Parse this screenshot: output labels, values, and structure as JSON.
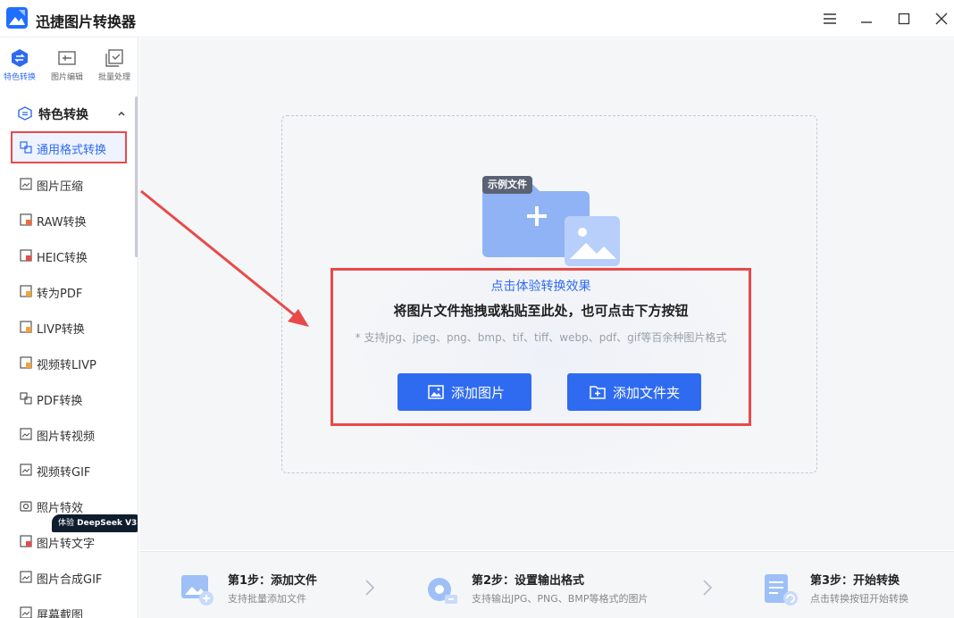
{
  "app": {
    "title": "迅捷图片转换器",
    "accent_color": "#2f6bf0",
    "highlight_color": "#e84a4a"
  },
  "window_controls": {
    "menu_icon": "hamburger-icon",
    "minimize_icon": "minimize-icon",
    "maximize_icon": "maximize-icon",
    "close_icon": "close-icon"
  },
  "top_tabs": [
    {
      "label": "特色转换",
      "icon": "swap-icon",
      "active": true
    },
    {
      "label": "图片编辑",
      "icon": "image-edit-icon",
      "active": false
    },
    {
      "label": "批量处理",
      "icon": "batch-icon",
      "active": false
    }
  ],
  "section": {
    "label": "特色转换",
    "expanded": true
  },
  "menu": [
    {
      "label": "通用格式转换",
      "active": true
    },
    {
      "label": "图片压缩"
    },
    {
      "label": "RAW转换"
    },
    {
      "label": "HEIC转换"
    },
    {
      "label": "转为PDF"
    },
    {
      "label": "LIVP转换"
    },
    {
      "label": "视频转LIVP"
    },
    {
      "label": "PDF转换"
    },
    {
      "label": "图片转视频"
    },
    {
      "label": "视频转GIF"
    },
    {
      "label": "照片特效"
    },
    {
      "label": "图片转文字"
    },
    {
      "label": "图片合成GIF"
    },
    {
      "label": "屏幕截图"
    }
  ],
  "deepseek_badge": {
    "prefix": "体验",
    "name": "DeepSeek",
    "version": "V3"
  },
  "dropzone": {
    "sample_badge": "示例文件",
    "try_link": "点击体验转换效果",
    "main_text": "将图片文件拖拽或粘贴至此处，也可点击下方按钮",
    "hint": "* 支持jpg、jpeg、png、bmp、tif、tiff、webp、pdf、gif等百余种图片格式",
    "add_image_label": "添加图片",
    "add_folder_label": "添加文件夹"
  },
  "steps": [
    {
      "title": "第1步：添加文件",
      "desc": "支持批量添加文件"
    },
    {
      "title": "第2步：设置输出格式",
      "desc": "支持输出JPG、PNG、BMP等格式的图片"
    },
    {
      "title": "第3步：开始转换",
      "desc": "点击转换按钮开始转换"
    }
  ]
}
